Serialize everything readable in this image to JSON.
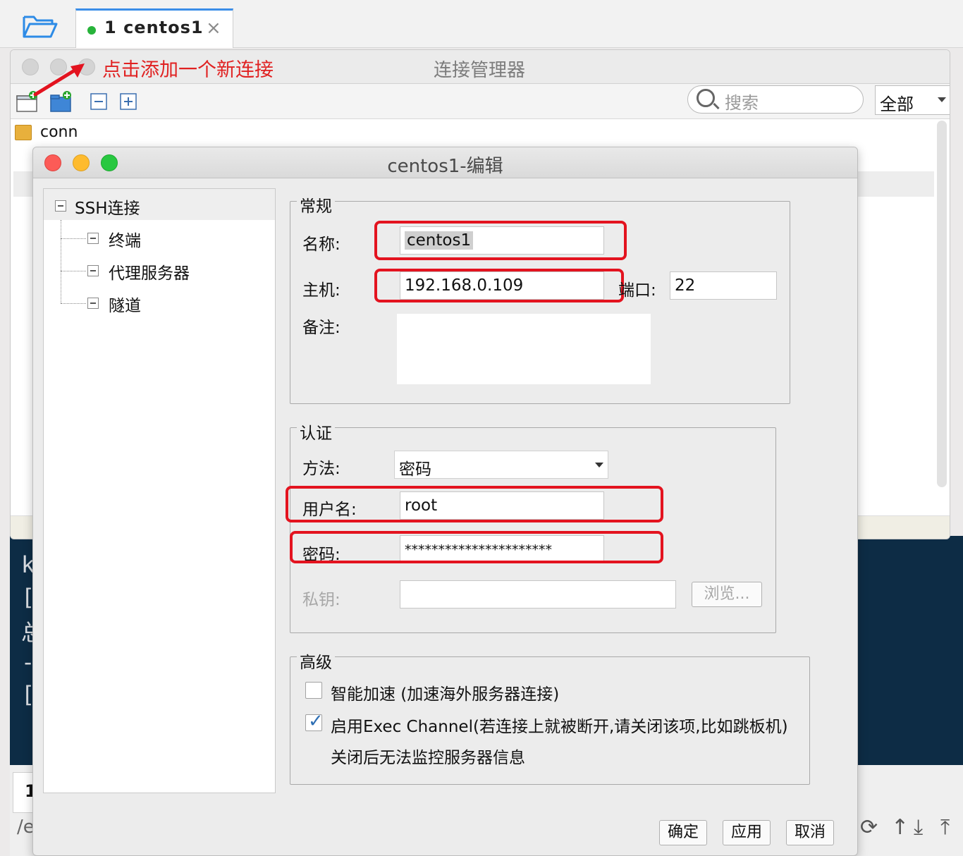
{
  "tabs": {
    "active": {
      "number": "1",
      "name": "centos1",
      "status_color": "#27b33a"
    }
  },
  "manager": {
    "title": "连接管理器",
    "hint": "点击添加一个新连接",
    "search_placeholder": "搜索",
    "filter_value": "全部",
    "tree_root": "conn"
  },
  "annotation_color": "#e3131f",
  "dialog": {
    "title": "centos1-编辑",
    "nav": {
      "root": "SSH连接",
      "children": [
        "终端",
        "代理服务器",
        "隧道"
      ]
    },
    "general": {
      "legend": "常规",
      "name_label": "名称:",
      "name_value": "centos1",
      "host_label": "主机:",
      "host_value": "192.168.0.109",
      "port_label": "端口:",
      "port_value": "22",
      "note_label": "备注:",
      "note_value": ""
    },
    "auth": {
      "legend": "认证",
      "method_label": "方法:",
      "method_value": "密码",
      "user_label": "用户名:",
      "user_value": "root",
      "password_label": "密码:",
      "password_value": "**********************",
      "key_label": "私钥:",
      "key_value": "",
      "browse_label": "浏览..."
    },
    "advanced": {
      "legend": "高级",
      "smart_accel_label": "智能加速 (加速海外服务器连接)",
      "smart_accel_checked": false,
      "exec_channel_label": "启用Exec Channel(若连接上就被断开,请关闭该项,比如跳板机)",
      "exec_channel_checked": true,
      "exec_channel_note": "关闭后无法监控服务器信息"
    },
    "buttons": {
      "ok": "确定",
      "apply": "应用",
      "cancel": "取消"
    }
  },
  "background": {
    "terminal_glyphs": [
      "k",
      "[",
      "总",
      "-",
      "["
    ],
    "bottom_tab": "1",
    "bottom_path": "/e"
  }
}
